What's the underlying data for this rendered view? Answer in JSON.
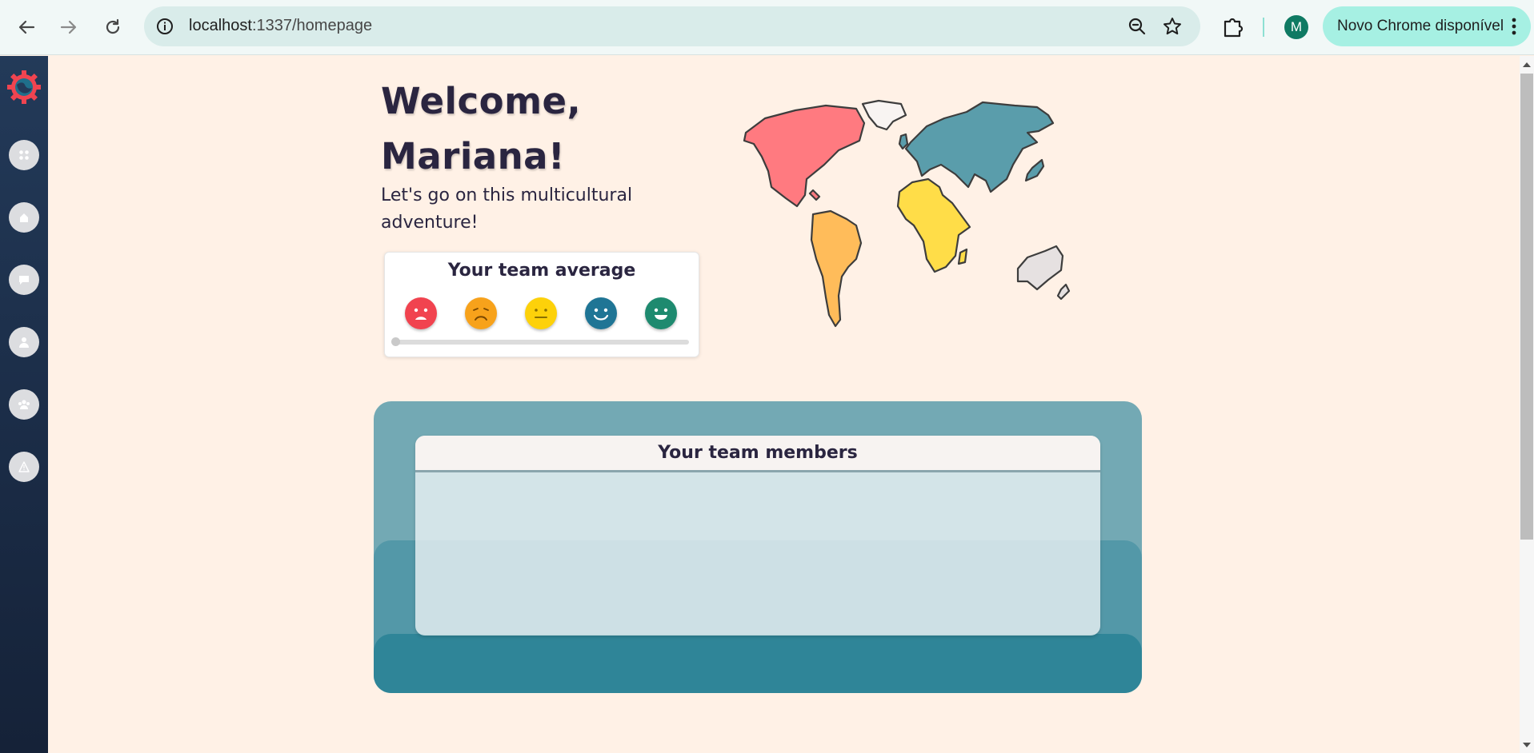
{
  "browser": {
    "url_host": "localhost",
    "url_rest": ":1337/homepage",
    "avatar_letter": "M",
    "update_label": "Novo Chrome disponível"
  },
  "sidebar": {
    "items": [
      {
        "name": "dashboard",
        "icon": "grid-icon"
      },
      {
        "name": "home",
        "icon": "house-icon"
      },
      {
        "name": "chat",
        "icon": "chat-bubble-icon"
      },
      {
        "name": "profile",
        "icon": "person-icon"
      },
      {
        "name": "team",
        "icon": "group-icon"
      },
      {
        "name": "alerts",
        "icon": "warning-icon"
      }
    ]
  },
  "welcome": {
    "line1": "Welcome,",
    "line2": "Mariana!",
    "subtitle": "Let's go on this multicultural adventure!"
  },
  "team_average": {
    "title": "Your team average",
    "faces": [
      {
        "mood": "very-sad",
        "color": "#f1434f"
      },
      {
        "mood": "sad",
        "color": "#f7a21b"
      },
      {
        "mood": "neutral",
        "color": "#fdd10a"
      },
      {
        "mood": "happy",
        "color": "#1f7595"
      },
      {
        "mood": "very-happy",
        "color": "#1e8a6f"
      }
    ],
    "slider_value": 0
  },
  "map": {
    "continent_colors": {
      "north_america": "#ff7a80",
      "south_america": "#ffbc5a",
      "europe_asia": "#5a9dab",
      "africa": "#ffdd48",
      "oceania": "#e6e1e1",
      "greenland": "#f8f4f2"
    }
  },
  "team_members": {
    "title": "Your team members"
  }
}
